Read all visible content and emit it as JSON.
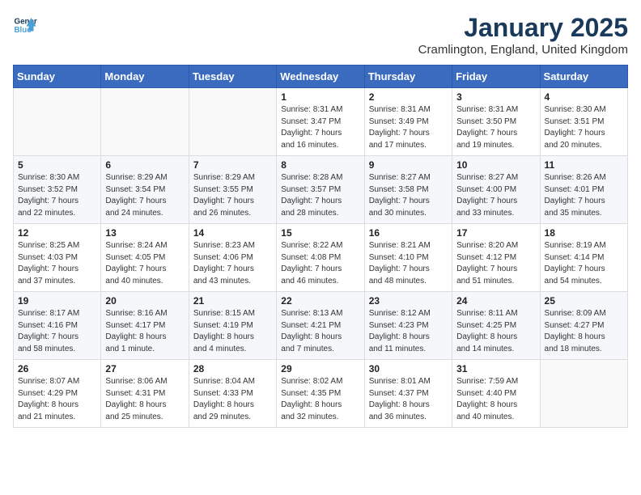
{
  "header": {
    "logo_line1": "General",
    "logo_line2": "Blue",
    "month": "January 2025",
    "location": "Cramlington, England, United Kingdom"
  },
  "weekdays": [
    "Sunday",
    "Monday",
    "Tuesday",
    "Wednesday",
    "Thursday",
    "Friday",
    "Saturday"
  ],
  "weeks": [
    [
      {
        "day": "",
        "content": ""
      },
      {
        "day": "",
        "content": ""
      },
      {
        "day": "",
        "content": ""
      },
      {
        "day": "1",
        "content": "Sunrise: 8:31 AM\nSunset: 3:47 PM\nDaylight: 7 hours\nand 16 minutes."
      },
      {
        "day": "2",
        "content": "Sunrise: 8:31 AM\nSunset: 3:49 PM\nDaylight: 7 hours\nand 17 minutes."
      },
      {
        "day": "3",
        "content": "Sunrise: 8:31 AM\nSunset: 3:50 PM\nDaylight: 7 hours\nand 19 minutes."
      },
      {
        "day": "4",
        "content": "Sunrise: 8:30 AM\nSunset: 3:51 PM\nDaylight: 7 hours\nand 20 minutes."
      }
    ],
    [
      {
        "day": "5",
        "content": "Sunrise: 8:30 AM\nSunset: 3:52 PM\nDaylight: 7 hours\nand 22 minutes."
      },
      {
        "day": "6",
        "content": "Sunrise: 8:29 AM\nSunset: 3:54 PM\nDaylight: 7 hours\nand 24 minutes."
      },
      {
        "day": "7",
        "content": "Sunrise: 8:29 AM\nSunset: 3:55 PM\nDaylight: 7 hours\nand 26 minutes."
      },
      {
        "day": "8",
        "content": "Sunrise: 8:28 AM\nSunset: 3:57 PM\nDaylight: 7 hours\nand 28 minutes."
      },
      {
        "day": "9",
        "content": "Sunrise: 8:27 AM\nSunset: 3:58 PM\nDaylight: 7 hours\nand 30 minutes."
      },
      {
        "day": "10",
        "content": "Sunrise: 8:27 AM\nSunset: 4:00 PM\nDaylight: 7 hours\nand 33 minutes."
      },
      {
        "day": "11",
        "content": "Sunrise: 8:26 AM\nSunset: 4:01 PM\nDaylight: 7 hours\nand 35 minutes."
      }
    ],
    [
      {
        "day": "12",
        "content": "Sunrise: 8:25 AM\nSunset: 4:03 PM\nDaylight: 7 hours\nand 37 minutes."
      },
      {
        "day": "13",
        "content": "Sunrise: 8:24 AM\nSunset: 4:05 PM\nDaylight: 7 hours\nand 40 minutes."
      },
      {
        "day": "14",
        "content": "Sunrise: 8:23 AM\nSunset: 4:06 PM\nDaylight: 7 hours\nand 43 minutes."
      },
      {
        "day": "15",
        "content": "Sunrise: 8:22 AM\nSunset: 4:08 PM\nDaylight: 7 hours\nand 46 minutes."
      },
      {
        "day": "16",
        "content": "Sunrise: 8:21 AM\nSunset: 4:10 PM\nDaylight: 7 hours\nand 48 minutes."
      },
      {
        "day": "17",
        "content": "Sunrise: 8:20 AM\nSunset: 4:12 PM\nDaylight: 7 hours\nand 51 minutes."
      },
      {
        "day": "18",
        "content": "Sunrise: 8:19 AM\nSunset: 4:14 PM\nDaylight: 7 hours\nand 54 minutes."
      }
    ],
    [
      {
        "day": "19",
        "content": "Sunrise: 8:17 AM\nSunset: 4:16 PM\nDaylight: 7 hours\nand 58 minutes."
      },
      {
        "day": "20",
        "content": "Sunrise: 8:16 AM\nSunset: 4:17 PM\nDaylight: 8 hours\nand 1 minute."
      },
      {
        "day": "21",
        "content": "Sunrise: 8:15 AM\nSunset: 4:19 PM\nDaylight: 8 hours\nand 4 minutes."
      },
      {
        "day": "22",
        "content": "Sunrise: 8:13 AM\nSunset: 4:21 PM\nDaylight: 8 hours\nand 7 minutes."
      },
      {
        "day": "23",
        "content": "Sunrise: 8:12 AM\nSunset: 4:23 PM\nDaylight: 8 hours\nand 11 minutes."
      },
      {
        "day": "24",
        "content": "Sunrise: 8:11 AM\nSunset: 4:25 PM\nDaylight: 8 hours\nand 14 minutes."
      },
      {
        "day": "25",
        "content": "Sunrise: 8:09 AM\nSunset: 4:27 PM\nDaylight: 8 hours\nand 18 minutes."
      }
    ],
    [
      {
        "day": "26",
        "content": "Sunrise: 8:07 AM\nSunset: 4:29 PM\nDaylight: 8 hours\nand 21 minutes."
      },
      {
        "day": "27",
        "content": "Sunrise: 8:06 AM\nSunset: 4:31 PM\nDaylight: 8 hours\nand 25 minutes."
      },
      {
        "day": "28",
        "content": "Sunrise: 8:04 AM\nSunset: 4:33 PM\nDaylight: 8 hours\nand 29 minutes."
      },
      {
        "day": "29",
        "content": "Sunrise: 8:02 AM\nSunset: 4:35 PM\nDaylight: 8 hours\nand 32 minutes."
      },
      {
        "day": "30",
        "content": "Sunrise: 8:01 AM\nSunset: 4:37 PM\nDaylight: 8 hours\nand 36 minutes."
      },
      {
        "day": "31",
        "content": "Sunrise: 7:59 AM\nSunset: 4:40 PM\nDaylight: 8 hours\nand 40 minutes."
      },
      {
        "day": "",
        "content": ""
      }
    ]
  ]
}
